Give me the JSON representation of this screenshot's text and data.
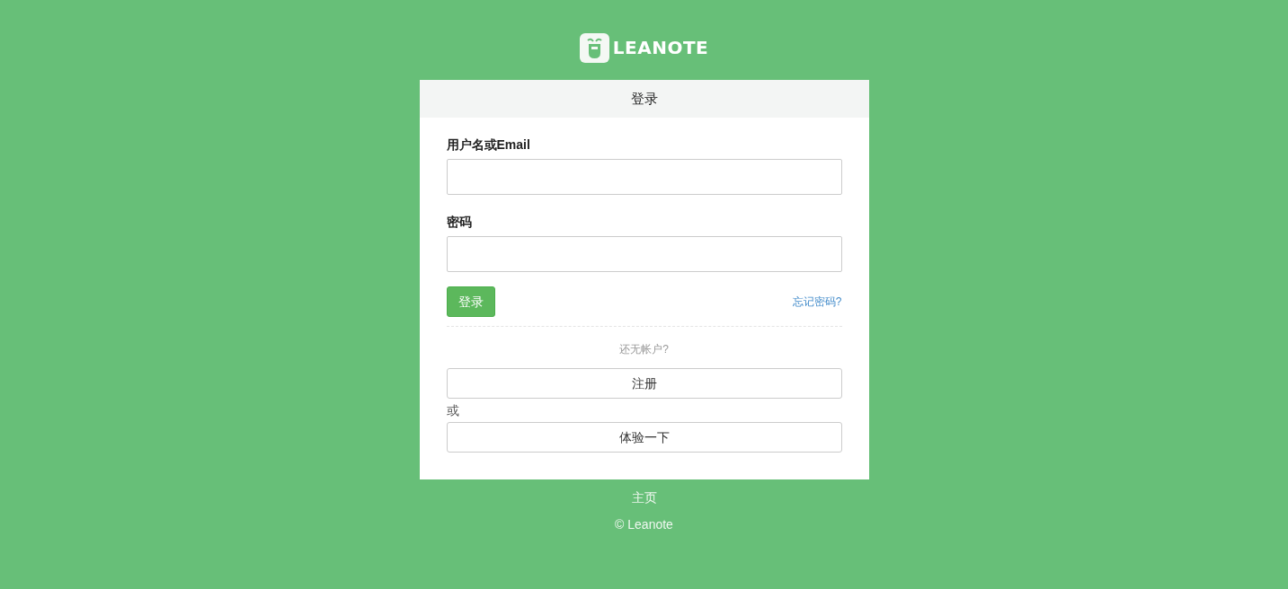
{
  "logo": {
    "text": "LEANOTE"
  },
  "login_card": {
    "title": "登录",
    "fields": [
      {
        "label": "用户名或Email"
      },
      {
        "label": "密码"
      }
    ],
    "submit_button": "登录",
    "forgot_link": "忘记密码?",
    "no_account_text": "还无帐户?",
    "register_button": "注册",
    "or_text": "或",
    "try_button": "体验一下"
  },
  "footer": {
    "home_link": "主页",
    "copyright": "© Leanote"
  }
}
